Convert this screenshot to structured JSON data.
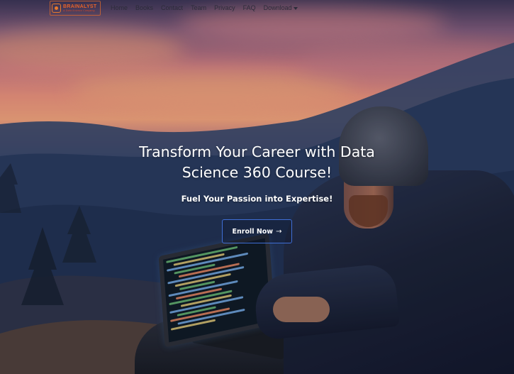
{
  "brand": {
    "name": "BRAINALYST",
    "tagline": "A Data Science Company",
    "logo_color": "#e8632a"
  },
  "nav": {
    "items": [
      "Home",
      "Books",
      "Contact",
      "Team",
      "Privacy",
      "FAQ"
    ],
    "dropdown_label": "Download",
    "dropdown_icon": "caret-down-icon"
  },
  "hero": {
    "title": "Transform Your Career with Data Science 360 Course!",
    "subtitle": "Fuel Your Passion into Expertise!",
    "cta_label": "Enroll Now",
    "cta_icon": "arrow-right-icon",
    "cta_arrow": "→",
    "accent_color": "#3f6fd6"
  }
}
